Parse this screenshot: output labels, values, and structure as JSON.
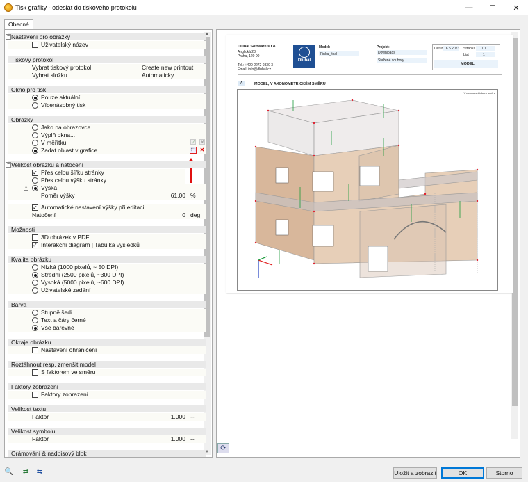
{
  "window": {
    "title": "Tisk grafiky - odeslat do tiskového protokolu",
    "min": "—",
    "max": "☐",
    "close": "✕"
  },
  "tab": "Obecné",
  "sections": {
    "nastaveni": "Nastavení pro obrázky",
    "uzivatelsky_nazev": "Uživatelský název",
    "tiskovy": "Tiskový protokol",
    "vybrat_protokol": "Vybrat tiskový protokol",
    "vybrat_protokol_val": "Create new printout report",
    "vybrat_slozku": "Vybrat složku",
    "vybrat_slozku_val": "Automaticky",
    "okno": "Okno pro tisk",
    "pouze": "Pouze aktuální",
    "vicenasobny": "Vícenásobný tisk",
    "obrazky": "Obrázky",
    "jako": "Jako na obrazovce",
    "vypln": "Výplň okna...",
    "meritko": "V měřítku",
    "zadat": "Zadat oblast v grafice",
    "velikost": "Velikost obrázku a natočení",
    "sirka": "Přes celou šířku stránky",
    "vyska_str": "Přes celou výšku stránky",
    "vyska": "Výška",
    "pomer": "Poměr výšky",
    "pomer_val": "61.00",
    "pomer_unit": "%",
    "auto": "Automatické nastavení výšky při editaci",
    "natoceni": "Natočení",
    "natoceni_val": "0",
    "natoceni_unit": "deg",
    "moznosti": "Možnosti",
    "pdf": "3D obrázek v PDF",
    "interaktivni": "Interakční diagram | Tabulka výsledků",
    "kvalita": "Kvalita obrázku",
    "nizka": "Nízká (1000 pixelů, ~ 50 DPI)",
    "stredni": "Střední (2500 pixelů, ~300 DPI)",
    "vysoka": "Vysoká (5000 pixelů, ~600 DPI)",
    "uzivatelske": "Uživatelské zadání",
    "barva": "Barva",
    "sedi": "Stupně šedi",
    "cerne": "Text a čáry černé",
    "barevne": "Vše barevně",
    "okraje": "Okraje obrázku",
    "ohraniceni": "Nastavení ohraničení",
    "roztahnout": "Roztáhnout resp. zmenšit model",
    "faktor_smer": "S faktorem ve směru",
    "faktory": "Faktory zobrazení",
    "faktory_zobr": "Faktory zobrazení",
    "velikost_textu": "Velikost textu",
    "faktor": "Faktor",
    "faktor_val": "1.000",
    "faktor_unit": "--",
    "velikost_symbolu": "Velikost symbolu",
    "faktor2": "Faktor",
    "faktor2_val": "1.000",
    "faktor2_unit": "--",
    "oramovani": "Orámování & nadpisový blok"
  },
  "page": {
    "company": "Dlubal Software s.r.o.",
    "addr1": "Anglická 28",
    "addr2": "Praha, 120 00",
    "tel": "Tel.: +420 2272 0330 3",
    "email": "Email: info@dlubal.cz",
    "logo": "Dlubal",
    "model_lbl": "Model:",
    "model_val": "Finka_final",
    "projekt_lbl": "Projekt:",
    "projekt_val": "Downloads",
    "projekt_val2": "Stažené soubory",
    "datum_lbl": "Datum",
    "datum_val": "16.5.2023",
    "strana_lbl": "Stránka",
    "strana_val": "1/1",
    "list_lbl": "List",
    "list_val": "1",
    "model_box": "MODEL",
    "section_num": "A",
    "section_title": "MODEL, V AXONOMETRICKÉM SMĚRU",
    "view_label": "V axonometrickém směru"
  },
  "buttons": {
    "save": "Uložit a zobrazit",
    "ok": "OK",
    "cancel": "Storno"
  }
}
